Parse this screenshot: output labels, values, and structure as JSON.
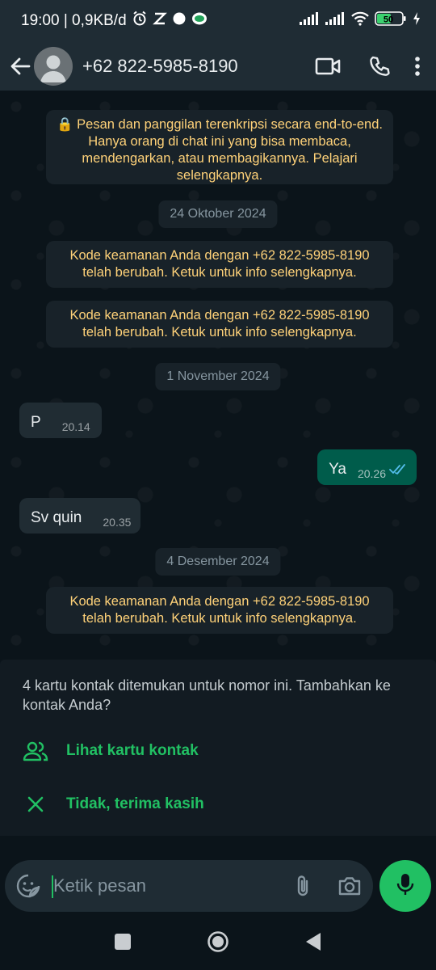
{
  "status_bar": {
    "time_info": "19:00 | 0,9KB/d",
    "battery": "50"
  },
  "header": {
    "contact": "+62 822-5985-8190",
    "icons": [
      "back-arrow-icon",
      "avatar",
      "video-call-icon",
      "voice-call-icon",
      "more-options-icon"
    ]
  },
  "chat": {
    "encryption_notice": "🔒 Pesan dan panggilan terenkripsi secara end-to-end. Hanya orang di chat ini yang bisa membaca, mendengarkan, atau membagikannya. Pelajari selengkapnya.",
    "dates": [
      "24 Oktober 2024",
      "1 November 2024",
      "4 Desember 2024"
    ],
    "security_notice": "Kode keamanan Anda dengan +62 822-5985-8190 telah berubah. Ketuk untuk info selengkapnya.",
    "messages": [
      {
        "direction": "in",
        "text": "P",
        "time": "20.14"
      },
      {
        "direction": "out",
        "text": "Ya",
        "time": "20.26",
        "status": "read"
      },
      {
        "direction": "in",
        "text": "Sv quin",
        "time": "20.35"
      }
    ]
  },
  "contact_card": {
    "text": "4 kartu kontak ditemukan untuk nomor ini. Tambahkan ke kontak Anda?",
    "view_label": "Lihat kartu kontak",
    "dismiss_label": "Tidak, terima kasih"
  },
  "composer": {
    "placeholder": "Ketik pesan"
  },
  "colors": {
    "accent": "#21c063",
    "system_text": "#ffd279",
    "outgoing_bubble": "#005c4b",
    "incoming_bubble": "#202c33",
    "read_ticks": "#53bdeb"
  }
}
